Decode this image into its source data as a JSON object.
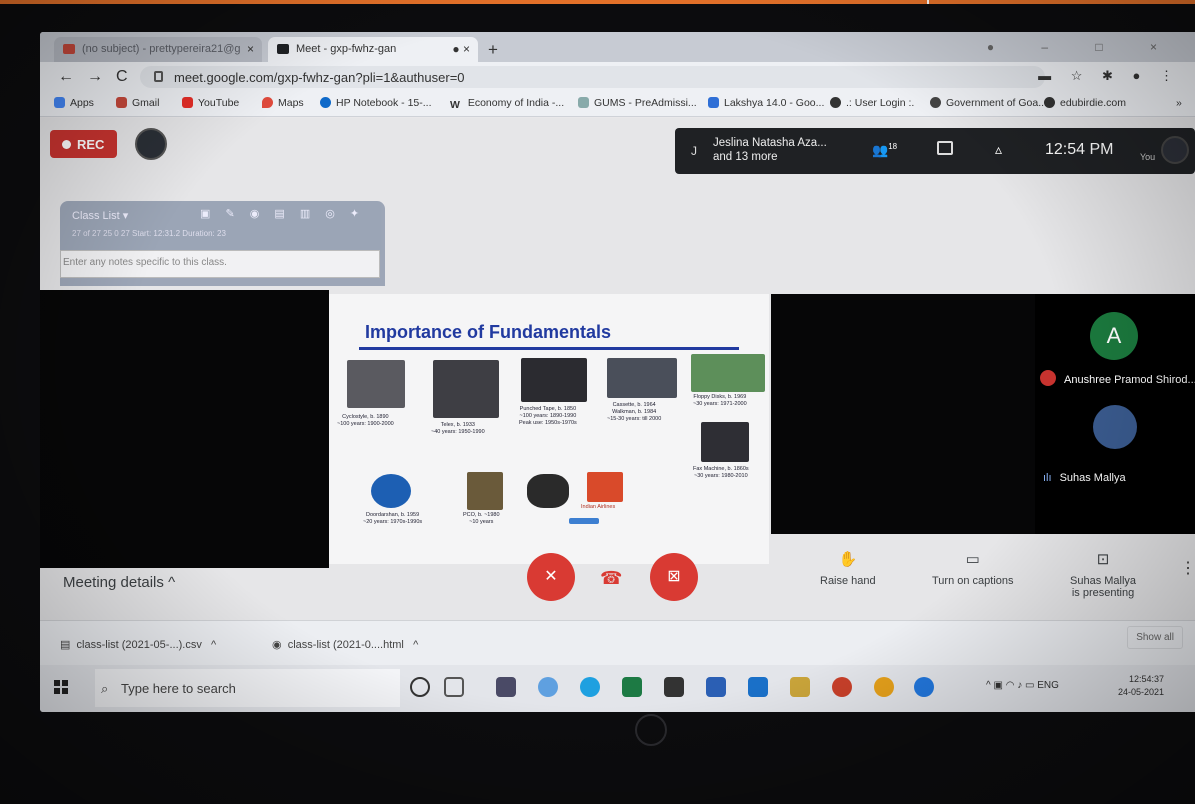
{
  "browser": {
    "tabs": [
      {
        "label": "(no subject) - prettypereira21@g"
      },
      {
        "label": "Meet - gxp-fwhz-gan"
      }
    ],
    "url": "meet.google.com/gxp-fwhz-gan?pli=1&authuser=0",
    "bookmarks": [
      "Apps",
      "Gmail",
      "YouTube",
      "Maps",
      "HP Notebook - 15-...",
      "Economy of India -...",
      "GUMS - PreAdmissi...",
      "Lakshya 14.0 - Goo...",
      ".: User Login :.",
      "Government of Goa...",
      "edubirdie.com"
    ]
  },
  "meet": {
    "rec_label": "REC",
    "first_initial": "J",
    "first_participant": "Jeslina Natasha Aza...",
    "more_participants": "and 13 more",
    "participant_count": "18",
    "time": "12:54 PM",
    "you_label": "You",
    "details_label": "Meeting details",
    "raise_hand": "Raise hand",
    "captions": "Turn on captions",
    "presenting_l1": "Suhas Mallya",
    "presenting_l2": "is presenting"
  },
  "class_list": {
    "title": "Class List ▾",
    "stats": "27 of 27   25   0   27   Start: 12:31.2  Duration: 23",
    "notes_placeholder": "Enter any notes specific to this class."
  },
  "slide": {
    "title": "Importance of Fundamentals",
    "captions": [
      {
        "l1": "Cyclostyle, b. 1890",
        "l2": "~100 years: 1900-2000"
      },
      {
        "l1": "Telex, b. 1933",
        "l2": "~40 years: 1950-1990"
      },
      {
        "l1": "Punched Tape, b. 1850",
        "l2": "~100 years: 1890-1990",
        "l3": "Peak use: 1950s-1970s"
      },
      {
        "l1": "Cassette, b. 1964",
        "l2": "Walkman, b. 1984",
        "l3": "~15-30 years: till 2000"
      },
      {
        "l1": "Floppy Disks, b. 1969",
        "l2": "~30 years: 1971-2000"
      },
      {
        "l1": "Fax Machine, b. 1860s",
        "l2": "~30 years: 1980-2010"
      },
      {
        "l1": "Doordarshan, b. 1959",
        "l2": "~20 years: 1970s-1990s"
      },
      {
        "l1": "PCO, b. ~1980",
        "l2": "~10 years"
      },
      {
        "l1": "Indian Airlines"
      }
    ]
  },
  "participants": [
    {
      "initial": "A",
      "name": "Anushree Pramod Shirod..."
    },
    {
      "name": "Suhas Mallya"
    }
  ],
  "downloads": [
    "class-list (2021-05-...).csv",
    "class-list (2021-0....html"
  ],
  "downloads_show_all": "Show all",
  "taskbar": {
    "search_placeholder": "Type here to search",
    "language": "ENG",
    "time": "12:54:37",
    "date": "24-05-2021"
  }
}
